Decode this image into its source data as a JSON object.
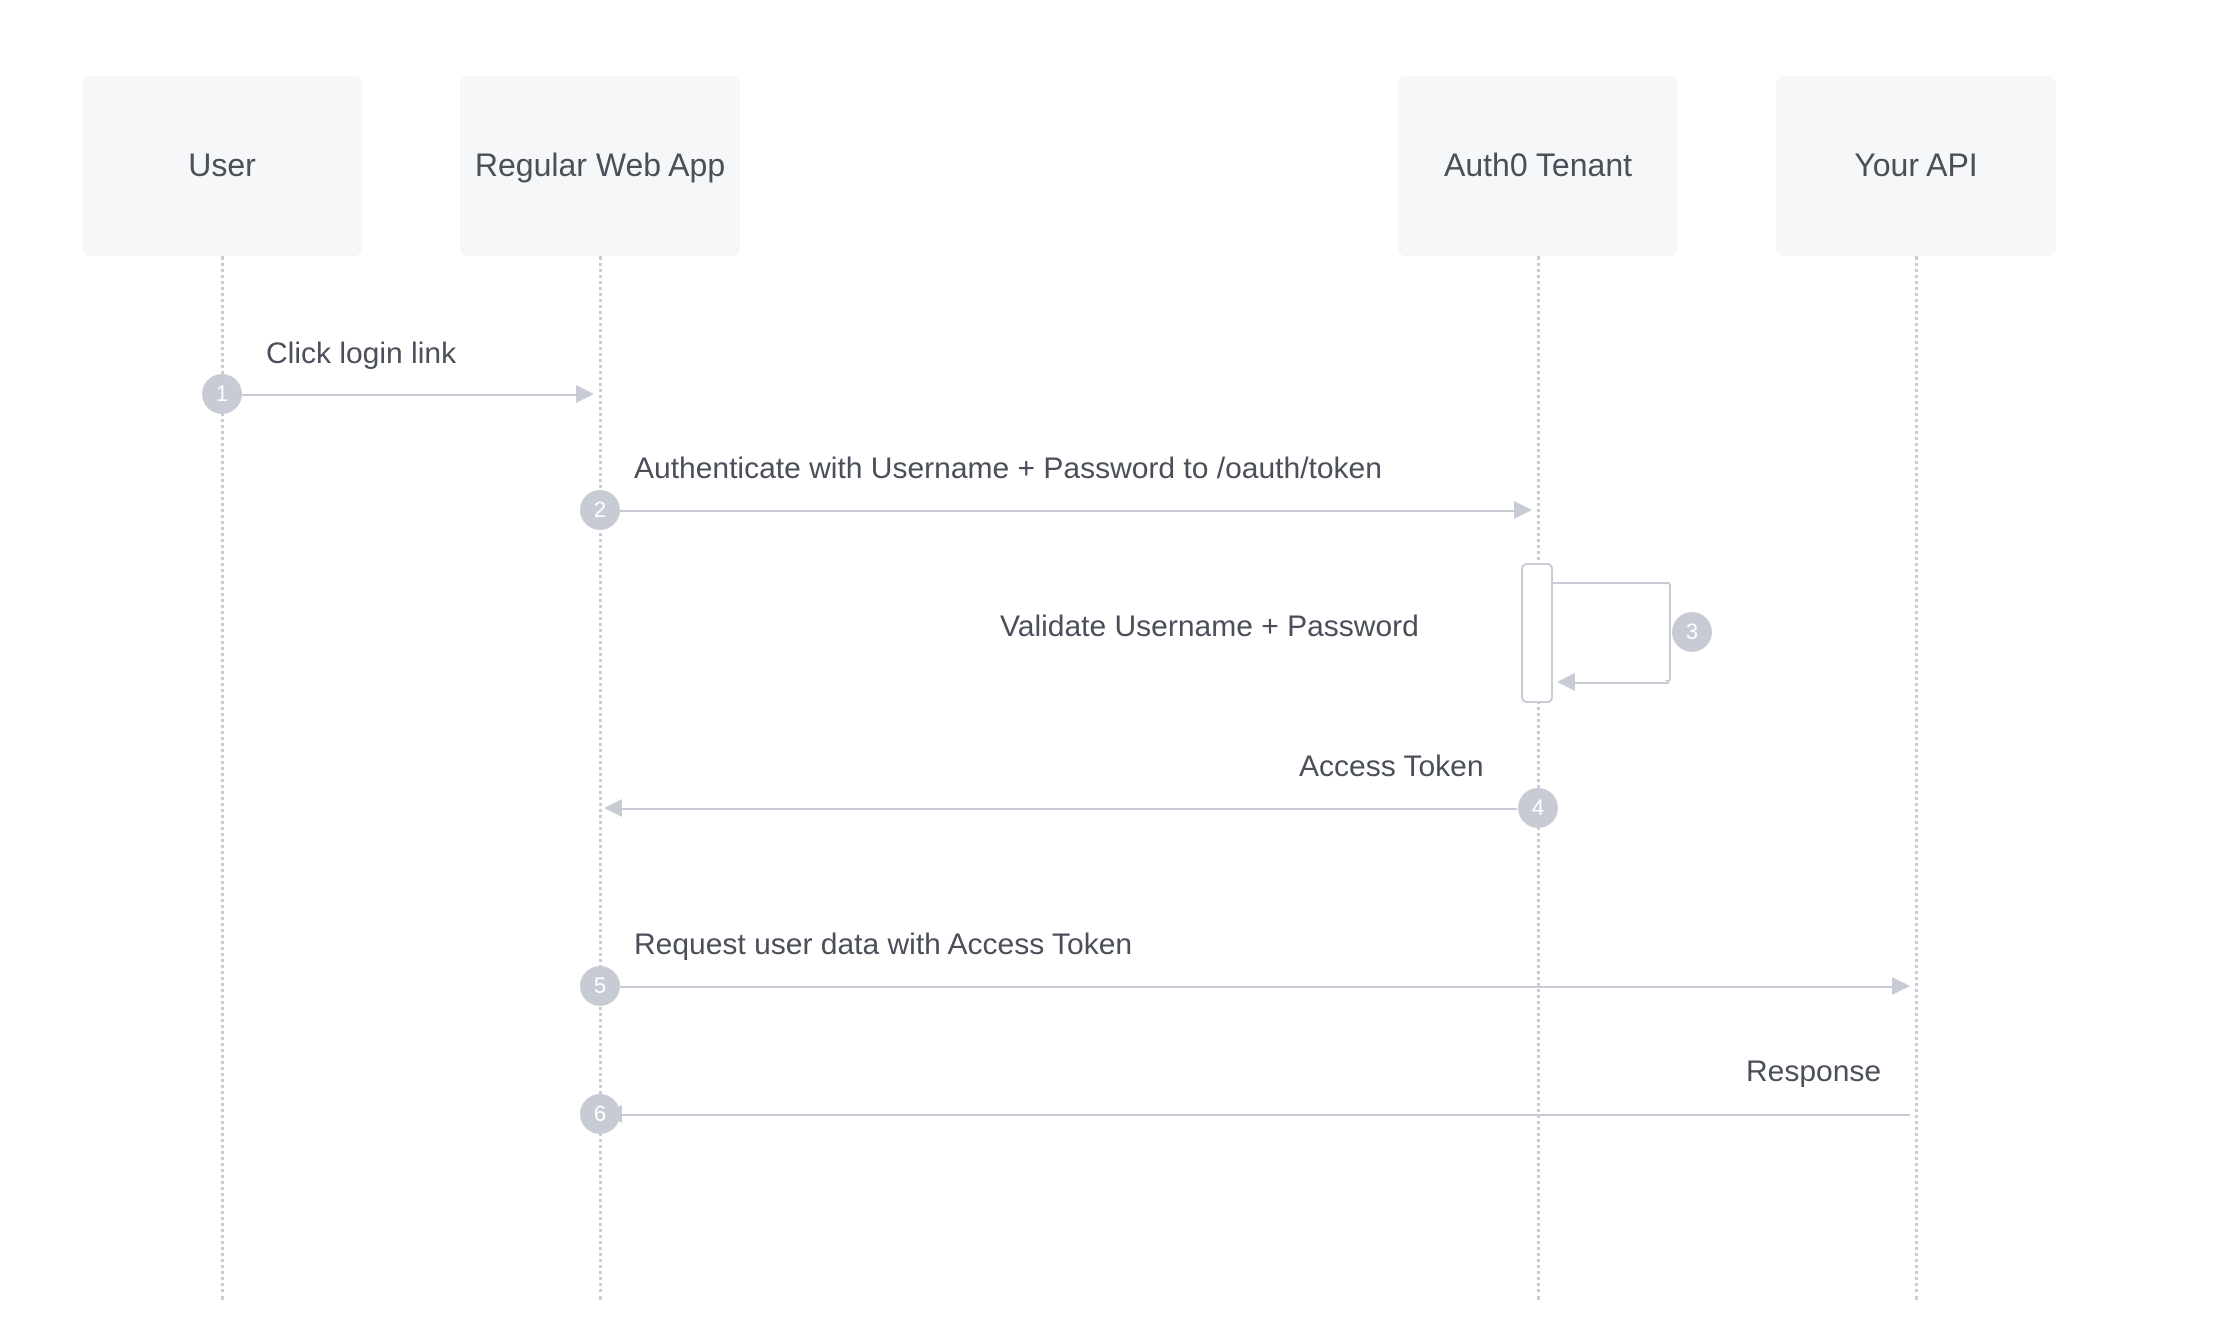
{
  "participants": {
    "user": "User",
    "webapp": "Regular Web App",
    "auth0": "Auth0 Tenant",
    "api": "Your API"
  },
  "steps": {
    "s1": {
      "num": "1",
      "label": "Click login link"
    },
    "s2": {
      "num": "2",
      "label": "Authenticate with Username + Password to /oauth/token"
    },
    "s3": {
      "num": "3",
      "label": "Validate Username + Password"
    },
    "s4": {
      "num": "4",
      "label": "Access Token"
    },
    "s5": {
      "num": "5",
      "label": "Request user data with Access Token"
    },
    "s6": {
      "num": "6",
      "label": "Response"
    }
  }
}
